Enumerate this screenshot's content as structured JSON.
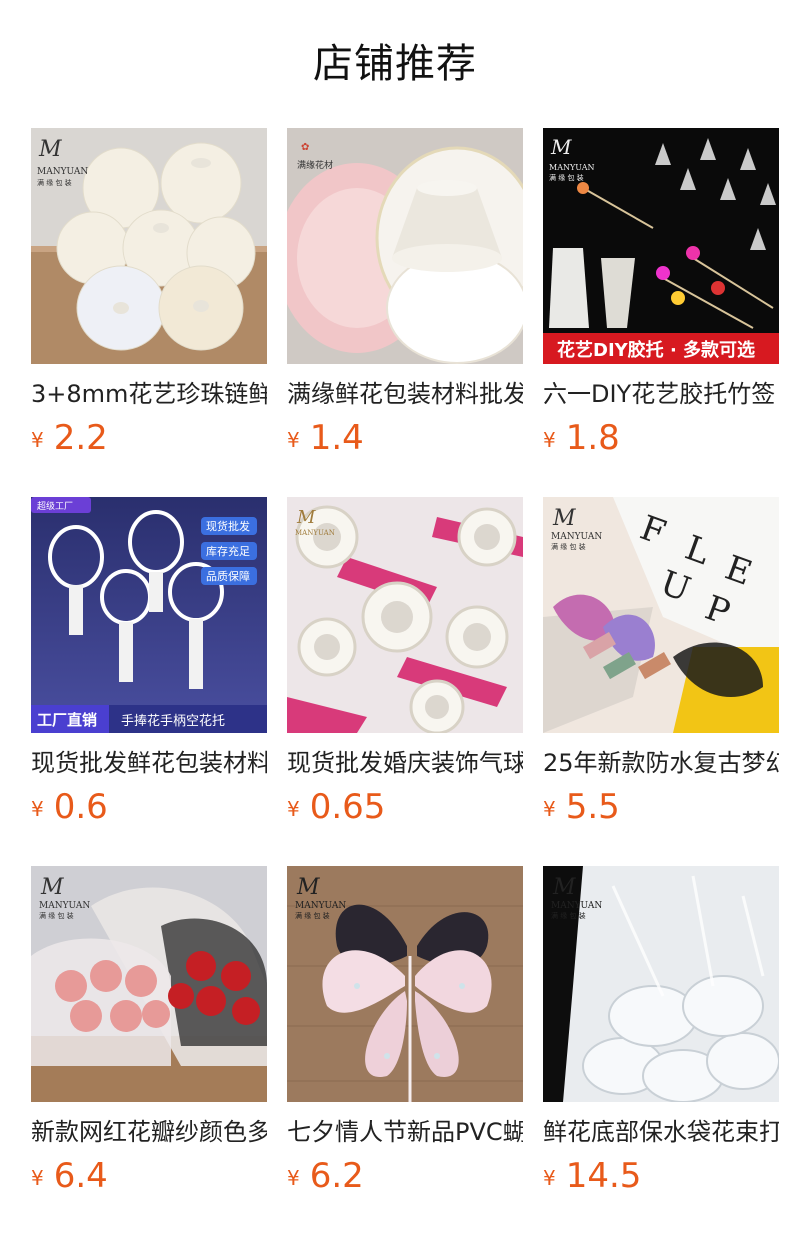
{
  "page": {
    "title": "店铺推荐"
  },
  "products": [
    {
      "name": "3+8mm花艺珍珠链鲜",
      "currency": "¥",
      "price": "2.2",
      "brand": "MANYUAN",
      "brand_cn": "满 缘 包 装"
    },
    {
      "name": "满缘鲜花包装材料批发",
      "currency": "¥",
      "price": "1.4",
      "brand": "满缘花材"
    },
    {
      "name": "六一DIY花艺胶托竹签",
      "currency": "¥",
      "price": "1.8",
      "brand": "MANYUAN",
      "brand_cn": "满 缘 包 装",
      "banner": "花艺DIY胶托 · 多款可选"
    },
    {
      "name": "现货批发鲜花包装材料",
      "currency": "¥",
      "price": "0.6",
      "badge": "超级工厂",
      "tags": [
        "现货批发",
        "库存充足",
        "品质保障"
      ],
      "banner_left": "工厂直销",
      "banner_right": "手捧花手柄空花托"
    },
    {
      "name": "现货批发婚庆装饰气球",
      "currency": "¥",
      "price": "0.65",
      "brand": "MANYUAN"
    },
    {
      "name": "25年新款防水复古梦幻",
      "currency": "¥",
      "price": "5.5",
      "brand": "MANYUAN",
      "brand_cn": "满 缘 包 装"
    },
    {
      "name": "新款网红花瓣纱颜色多",
      "currency": "¥",
      "price": "6.4",
      "brand": "MANYUAN",
      "brand_cn": "满 缘 包 装"
    },
    {
      "name": "七夕情人节新品PVC蝴蝶",
      "currency": "¥",
      "price": "6.2",
      "brand": "MANYUAN",
      "brand_cn": "满 缘 包 装"
    },
    {
      "name": "鲜花底部保水袋花束打",
      "currency": "¥",
      "price": "14.5",
      "brand": "MANYUAN",
      "brand_cn": "满 缘 包 装"
    }
  ],
  "colors": {
    "price": "#e85a1a",
    "title": "#111111"
  }
}
